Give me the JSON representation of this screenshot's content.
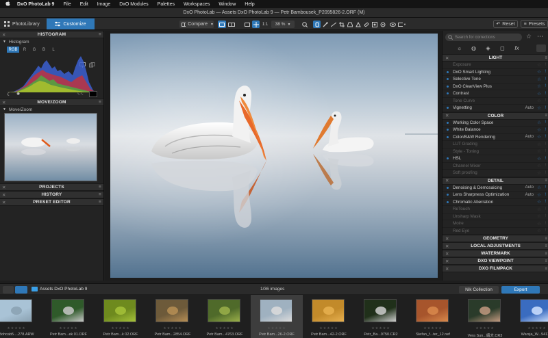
{
  "menubar": {
    "apple": "",
    "items": [
      "DxO PhotoLab 9",
      "File",
      "Edit",
      "Image",
      "DxO Modules",
      "Palettes",
      "Workspaces",
      "Window",
      "Help"
    ]
  },
  "window": {
    "title": "DxO PhotoLab — Assets DxO PhotoLab 9 — Petr Bambousek_P2095826-2.ORF (M)"
  },
  "toolbar": {
    "photolibrary": "PhotoLibrary",
    "customize": "Customize",
    "compare": "Compare",
    "one_to_one": "1:1",
    "zoom": "38 %",
    "reset": "Reset",
    "presets": "Presets"
  },
  "left": {
    "histogram_title": "HISTOGRAM",
    "histogram_sub": "Histogram",
    "channels": [
      "RGB",
      "R",
      "G",
      "B",
      "L"
    ],
    "movezoom_title": "MOVE/ZOOM",
    "movezoom_sub": "Move/Zoom",
    "projects": "PROJECTS",
    "history": "HISTORY",
    "preset_editor": "PRESET EDITOR"
  },
  "right": {
    "search_placeholder": "Search for corrections",
    "sections": [
      {
        "title": "LIGHT",
        "rows": [
          {
            "label": "Exposure",
            "active": false,
            "auto": ""
          },
          {
            "label": "DxO Smart Lighting",
            "active": true,
            "auto": ""
          },
          {
            "label": "Selective Tone",
            "active": true,
            "auto": ""
          },
          {
            "label": "DxO ClearView Plus",
            "active": true,
            "auto": ""
          },
          {
            "label": "Contrast",
            "active": true,
            "auto": ""
          },
          {
            "label": "Tone Curve",
            "active": false,
            "auto": ""
          },
          {
            "label": "Vignetting",
            "active": true,
            "auto": "Auto"
          }
        ]
      },
      {
        "title": "COLOR",
        "rows": [
          {
            "label": "Working Color Space",
            "active": true,
            "auto": ""
          },
          {
            "label": "White Balance",
            "active": true,
            "auto": ""
          },
          {
            "label": "Color/B&W Rendering",
            "active": true,
            "auto": "Auto"
          },
          {
            "label": "LUT Grading",
            "active": false,
            "auto": ""
          },
          {
            "label": "Style - Toning",
            "active": false,
            "auto": ""
          },
          {
            "label": "HSL",
            "active": true,
            "auto": ""
          },
          {
            "label": "Channel Mixer",
            "active": false,
            "auto": ""
          },
          {
            "label": "Soft proofing",
            "active": false,
            "auto": ""
          }
        ]
      },
      {
        "title": "DETAIL",
        "rows": [
          {
            "label": "Denoising & Demosaicing",
            "active": true,
            "auto": "Auto"
          },
          {
            "label": "Lens Sharpness Optimization",
            "active": true,
            "auto": "Auto"
          },
          {
            "label": "Chromatic Aberration",
            "active": true,
            "auto": ""
          },
          {
            "label": "ReTouch",
            "active": false,
            "auto": ""
          },
          {
            "label": "Unsharp Mask",
            "active": false,
            "auto": ""
          },
          {
            "label": "Moire",
            "active": false,
            "auto": ""
          },
          {
            "label": "Red Eye",
            "active": false,
            "auto": ""
          }
        ]
      }
    ],
    "collapsed": [
      "GEOMETRY",
      "LOCAL ADJUSTMENTS",
      "WATERMARK",
      "DXO VIEWPOINT",
      "DXO FILMPACK"
    ]
  },
  "filmstrip": {
    "folder": "Assets DxO PhotoLab 9",
    "count": "1/36 images",
    "nik": "Nik Collection",
    "export": "Export",
    "thumbs": [
      {
        "name": "Bohcab5....278.ARW",
        "bg": "#a9c3d6",
        "fg": "#8aa1b1"
      },
      {
        "name": "Petr Bam...ek 01.ORF",
        "bg": "#2f5a2a",
        "fg": "#c8c8c8"
      },
      {
        "name": "Petr Bam...k 02.ORF",
        "bg": "#6e8a1e",
        "fg": "#a6c23a"
      },
      {
        "name": "Petr Bam...2854.ORF",
        "bg": "#6d5a3a",
        "fg": "#b78f55"
      },
      {
        "name": "Petr Bam...4763.ORF",
        "bg": "#4f6a2a",
        "fg": "#9bb04a"
      },
      {
        "name": "Petr Bam...26-2.ORF",
        "bg": "#9fb1c0",
        "fg": "#dcdcdc"
      },
      {
        "name": "Petr Bam...42-2.ORF",
        "bg": "#c28a2a",
        "fg": "#e7b050"
      },
      {
        "name": "Petr_Ba...9750.CR2",
        "bg": "#20301a",
        "fg": "#cfcfcf"
      },
      {
        "name": "Stefan_f...ter_12.nef",
        "bg": "#a7552c",
        "fg": "#d98a4c"
      },
      {
        "name": "Vera Sun...緒夫.CR3",
        "bg": "#2a3b2a",
        "fg": "#c29a80"
      },
      {
        "name": "Warsja_W...9411.C",
        "bg": "#3a6cc0",
        "fg": "#d0e2ff"
      }
    ]
  },
  "colors": {
    "accent": "#2f78b8",
    "panel": "#232323",
    "header": "#303030"
  }
}
